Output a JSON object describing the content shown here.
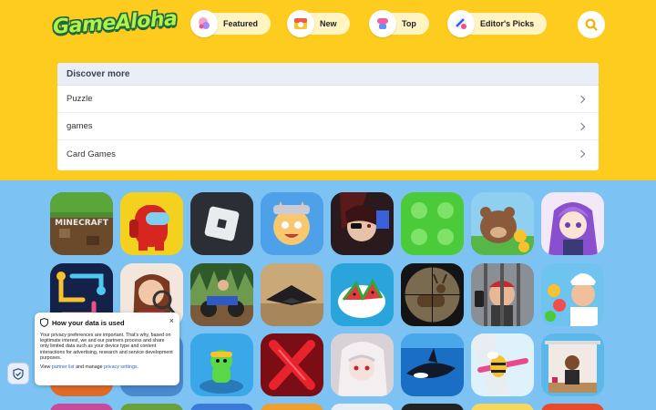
{
  "brand": {
    "logo_text": "GameAloha"
  },
  "nav": {
    "featured_label": "Featured",
    "new_label": "New",
    "top_label": "Top",
    "editors_label": "Editor's Picks"
  },
  "discover": {
    "title": "Discover more",
    "items": [
      {
        "label": "Puzzle"
      },
      {
        "label": "games"
      },
      {
        "label": "Card Games"
      }
    ]
  },
  "games": {
    "row1": [
      "minecraft",
      "among-us",
      "roblox",
      "cat-hero",
      "assassin",
      "green-blocks",
      "bear-coins",
      "anime-girl"
    ],
    "row2": [
      "flow-lines",
      "detective-woman",
      "atv-racing",
      "stealth-jet",
      "fruit-slice",
      "deer-hunter",
      "prison-escape",
      "chef-bubbles"
    ],
    "row3": [
      "green-runner",
      "red-x",
      "white-hair-girl",
      "orca",
      "bee-fly",
      "house-visitor"
    ]
  },
  "privacy": {
    "title": "How your data is used",
    "body": "Your privacy preferences are important. That's why, based on legitimate interest, we and our partners process and share only limited data such as your device type and content interactions for advertising, research and service development purposes.",
    "links_prefix": "View",
    "partner_link": "partner list",
    "links_middle": "and manage",
    "settings_link": "privacy settings",
    "links_suffix": ".",
    "close_glyph": "×"
  },
  "colors": {
    "header_bg": "#fdcc1f",
    "page_bg": "#7cc3f4",
    "pill_bg": "#fff4c2",
    "logo_green": "#b6f04c"
  }
}
